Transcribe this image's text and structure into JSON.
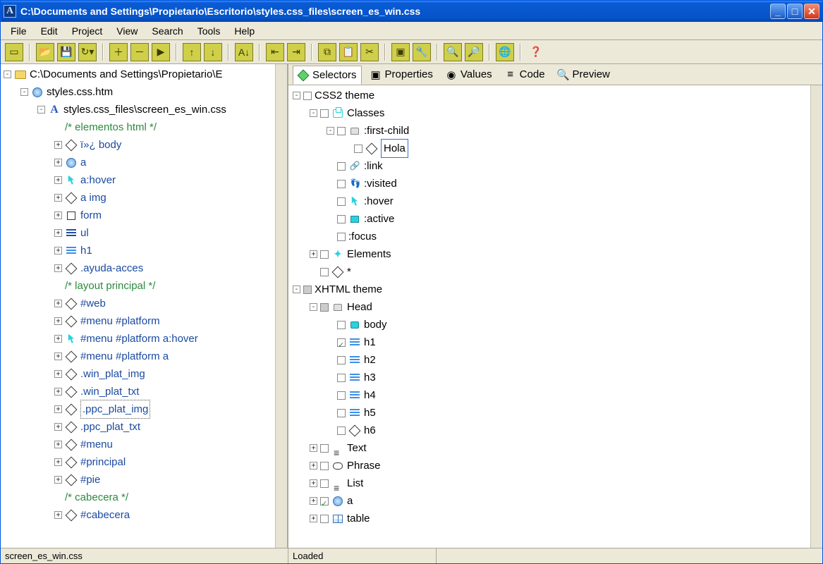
{
  "window": {
    "title": "C:\\Documents and Settings\\Propietario\\Escritorio\\styles.css_files\\screen_es_win.css"
  },
  "menu": [
    "File",
    "Edit",
    "Project",
    "View",
    "Search",
    "Tools",
    "Help"
  ],
  "tabs": {
    "selectors": "Selectors",
    "properties": "Properties",
    "values": "Values",
    "code": "Code",
    "preview": "Preview"
  },
  "left_tree": [
    {
      "indent": 0,
      "exp": "-",
      "icon": "folder",
      "text": "C:\\Documents and Settings\\Propietario\\E",
      "cls": ""
    },
    {
      "indent": 1,
      "exp": "-",
      "icon": "ie",
      "text": "styles.css.htm",
      "cls": ""
    },
    {
      "indent": 2,
      "exp": "-",
      "icon": "A",
      "text": "styles.css_files\\screen_es_win.css",
      "cls": ""
    },
    {
      "indent": 3,
      "exp": "",
      "icon": "",
      "text": "/* elementos html */",
      "cls": "comment"
    },
    {
      "indent": 3,
      "exp": "+",
      "icon": "diamond",
      "text": "ï»¿ body",
      "cls": "sel-color"
    },
    {
      "indent": 3,
      "exp": "+",
      "icon": "globe",
      "text": "a",
      "cls": "sel-color"
    },
    {
      "indent": 3,
      "exp": "+",
      "icon": "cursor",
      "text": "a:hover",
      "cls": "sel-color"
    },
    {
      "indent": 3,
      "exp": "+",
      "icon": "diamond",
      "text": "a img",
      "cls": "sel-color"
    },
    {
      "indent": 3,
      "exp": "+",
      "icon": "square",
      "text": "form",
      "cls": "sel-color"
    },
    {
      "indent": 3,
      "exp": "+",
      "icon": "list",
      "text": "ul",
      "cls": "sel-color"
    },
    {
      "indent": 3,
      "exp": "+",
      "icon": "lines",
      "text": "h1",
      "cls": "sel-color"
    },
    {
      "indent": 3,
      "exp": "+",
      "icon": "diamond",
      "text": ".ayuda-acces",
      "cls": "sel-color"
    },
    {
      "indent": 3,
      "exp": "",
      "icon": "",
      "text": "/* layout principal */",
      "cls": "comment"
    },
    {
      "indent": 3,
      "exp": "+",
      "icon": "diamond",
      "text": "#web",
      "cls": "sel-color"
    },
    {
      "indent": 3,
      "exp": "+",
      "icon": "diamond",
      "text": "#menu #platform",
      "cls": "sel-color"
    },
    {
      "indent": 3,
      "exp": "+",
      "icon": "cursor",
      "text": "#menu #platform a:hover",
      "cls": "sel-color"
    },
    {
      "indent": 3,
      "exp": "+",
      "icon": "diamond",
      "text": "#menu #platform a",
      "cls": "sel-color"
    },
    {
      "indent": 3,
      "exp": "+",
      "icon": "diamond",
      "text": ".win_plat_img",
      "cls": "sel-color"
    },
    {
      "indent": 3,
      "exp": "+",
      "icon": "diamond",
      "text": ".win_plat_txt",
      "cls": "sel-color"
    },
    {
      "indent": 3,
      "exp": "+",
      "icon": "diamond",
      "text": ".ppc_plat_img",
      "cls": "sel-color selected"
    },
    {
      "indent": 3,
      "exp": "+",
      "icon": "diamond",
      "text": ".ppc_plat_txt",
      "cls": "sel-color"
    },
    {
      "indent": 3,
      "exp": "+",
      "icon": "diamond",
      "text": "#menu",
      "cls": "sel-color"
    },
    {
      "indent": 3,
      "exp": "+",
      "icon": "diamond",
      "text": "#principal",
      "cls": "sel-color"
    },
    {
      "indent": 3,
      "exp": "+",
      "icon": "diamond",
      "text": "#pie",
      "cls": "sel-color"
    },
    {
      "indent": 3,
      "exp": "",
      "icon": "",
      "text": "/* cabecera */",
      "cls": "comment"
    },
    {
      "indent": 3,
      "exp": "+",
      "icon": "diamond",
      "text": "#cabecera",
      "cls": "sel-color"
    }
  ],
  "right_tree": [
    {
      "indent": 0,
      "exp": "-",
      "chk": "u",
      "icon": "",
      "text": "CSS2 theme"
    },
    {
      "indent": 1,
      "exp": "-",
      "chk": "u",
      "icon": "brackets",
      "text": "Classes"
    },
    {
      "indent": 2,
      "exp": "-",
      "chk": "u",
      "icon": "head",
      "text": ":first-child"
    },
    {
      "indent": 3,
      "exp": "",
      "chk": "u",
      "icon": "diamond",
      "text": "Hola",
      "cls": "boxed"
    },
    {
      "indent": 2,
      "exp": "",
      "chk": "u",
      "icon": "link",
      "text": ":link"
    },
    {
      "indent": 2,
      "exp": "",
      "chk": "u",
      "icon": "feet",
      "text": ":visited"
    },
    {
      "indent": 2,
      "exp": "",
      "chk": "u",
      "icon": "cursor",
      "text": ":hover"
    },
    {
      "indent": 2,
      "exp": "",
      "chk": "u",
      "icon": "box-blue",
      "text": ":active"
    },
    {
      "indent": 2,
      "exp": "",
      "chk": "u",
      "icon": "",
      "text": ":focus"
    },
    {
      "indent": 1,
      "exp": "+",
      "chk": "u",
      "icon": "plus-el",
      "text": "Elements"
    },
    {
      "indent": 1,
      "exp": "",
      "chk": "u",
      "icon": "diamond",
      "text": "*"
    },
    {
      "indent": 0,
      "exp": "-",
      "chk": "g",
      "icon": "",
      "text": "XHTML theme"
    },
    {
      "indent": 1,
      "exp": "-",
      "chk": "g",
      "icon": "head",
      "text": "Head"
    },
    {
      "indent": 2,
      "exp": "",
      "chk": "u",
      "icon": "body",
      "text": "body"
    },
    {
      "indent": 2,
      "exp": "",
      "chk": "c",
      "icon": "lines",
      "text": "h1"
    },
    {
      "indent": 2,
      "exp": "",
      "chk": "u",
      "icon": "lines",
      "text": "h2"
    },
    {
      "indent": 2,
      "exp": "",
      "chk": "u",
      "icon": "lines",
      "text": "h3"
    },
    {
      "indent": 2,
      "exp": "",
      "chk": "u",
      "icon": "lines",
      "text": "h4"
    },
    {
      "indent": 2,
      "exp": "",
      "chk": "u",
      "icon": "lines",
      "text": "h5"
    },
    {
      "indent": 2,
      "exp": "",
      "chk": "u",
      "icon": "diamond",
      "text": "h6"
    },
    {
      "indent": 1,
      "exp": "+",
      "chk": "u",
      "icon": "listico",
      "text": "Text"
    },
    {
      "indent": 1,
      "exp": "+",
      "chk": "u",
      "icon": "phrase",
      "text": "Phrase"
    },
    {
      "indent": 1,
      "exp": "+",
      "chk": "u",
      "icon": "listico",
      "text": "List"
    },
    {
      "indent": 1,
      "exp": "+",
      "chk": "c",
      "icon": "globe",
      "text": "a"
    },
    {
      "indent": 1,
      "exp": "+",
      "chk": "u",
      "icon": "table",
      "text": "table"
    }
  ],
  "status": {
    "left": "screen_es_win.css",
    "right": "Loaded"
  }
}
